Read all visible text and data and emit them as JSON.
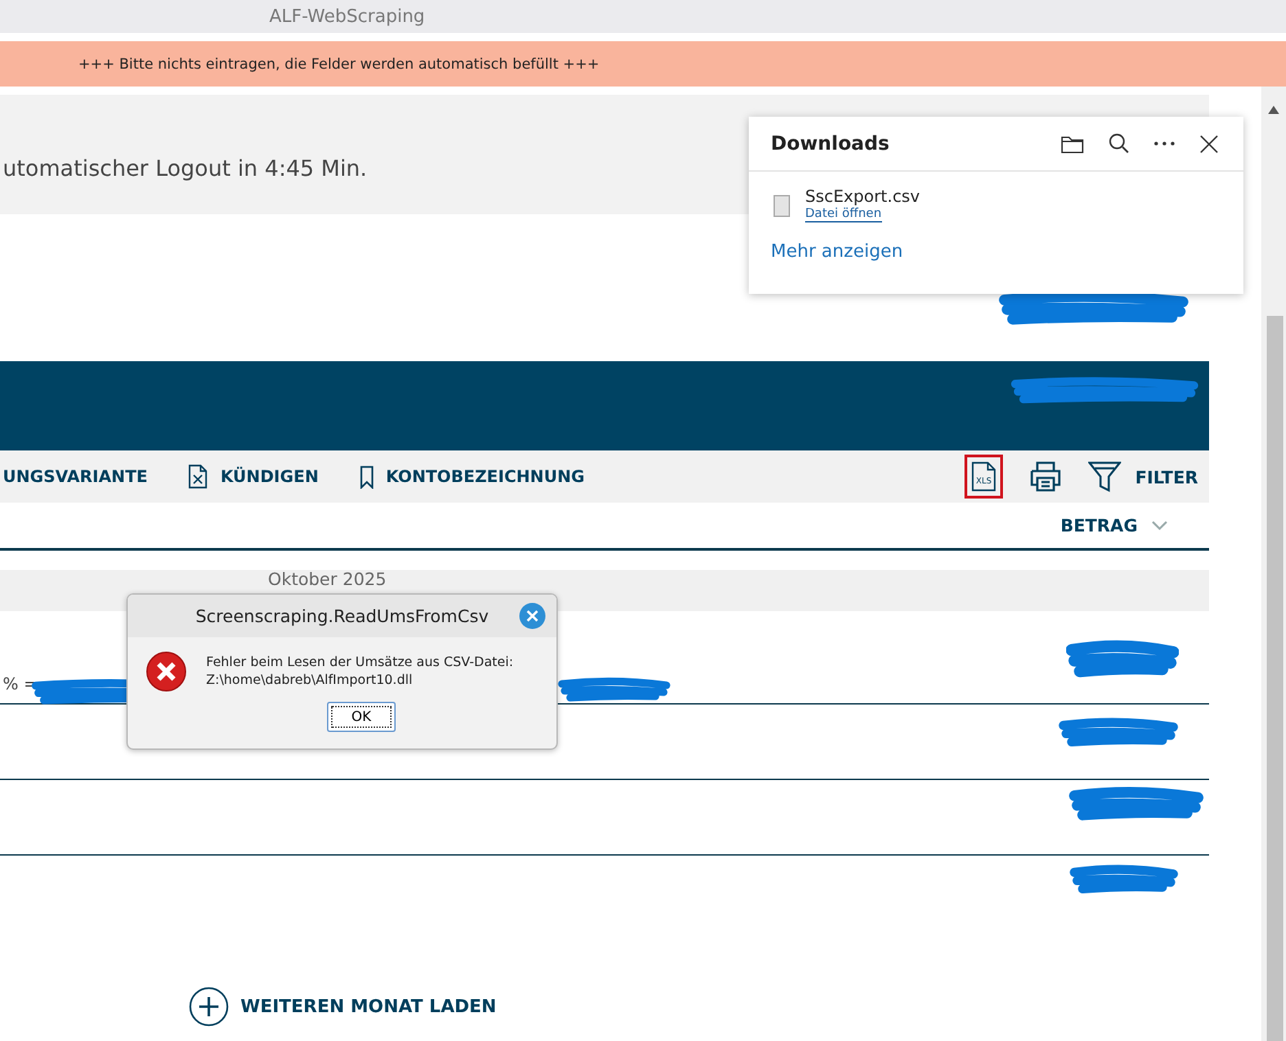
{
  "window": {
    "title": "ALF-WebScraping"
  },
  "banner": {
    "text": "+++ Bitte nichts eintragen, die Felder werden automatisch befüllt +++"
  },
  "logout": {
    "text": "utomatischer Logout in 4:45 Min."
  },
  "toolbar": {
    "actions": [
      {
        "label": "UNGSVARIANTE",
        "kind": "plain"
      },
      {
        "label": "KÜNDIGEN",
        "kind": "document"
      },
      {
        "label": "KONTOBEZEICHNUNG",
        "kind": "bookmark"
      }
    ],
    "export_label": "XLS",
    "export_highlighted": true,
    "filter_label": "FILTER"
  },
  "sort": {
    "label": "BETRAG"
  },
  "month": {
    "label": "Oktober 2025"
  },
  "first_row_text": "% =",
  "load_more": {
    "label": "WEITEREN MONAT LADEN"
  },
  "downloads": {
    "title": "Downloads",
    "file": "SscExport.csv",
    "open_link": "Datei öffnen",
    "more_link": "Mehr anzeigen"
  },
  "dialog": {
    "title": "Screenscraping.ReadUmsFromCsv",
    "message_lines": [
      "Fehler beim Lesen der Umsätze aus CSV-Datei:",
      "Z:\\home\\dabreb\\AlfImport10.dll"
    ],
    "button": "OK"
  }
}
